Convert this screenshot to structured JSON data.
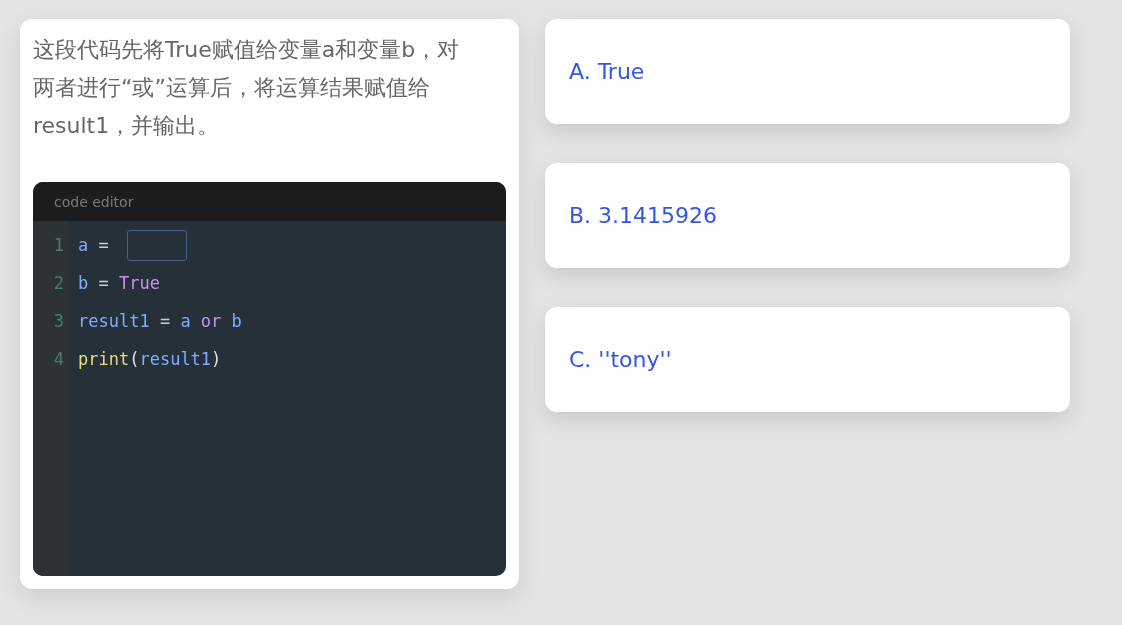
{
  "question": {
    "text": "这段代码先将True赋值给变量a和变量b，对两者进行“或”运算后，将运算结果赋值给result1，并输出。"
  },
  "code_editor": {
    "title": "code editor",
    "lines": [
      {
        "number": "1",
        "tokens": [
          {
            "kind": "variable",
            "text": "a"
          },
          {
            "kind": "operator",
            "text": " = "
          },
          {
            "kind": "blank"
          }
        ]
      },
      {
        "number": "2",
        "tokens": [
          {
            "kind": "variable",
            "text": "b"
          },
          {
            "kind": "operator",
            "text": " = "
          },
          {
            "kind": "boolean",
            "text": "True"
          }
        ]
      },
      {
        "number": "3",
        "tokens": [
          {
            "kind": "variable",
            "text": "result1"
          },
          {
            "kind": "operator",
            "text": " = "
          },
          {
            "kind": "variable",
            "text": "a"
          },
          {
            "kind": "keyword",
            "text": " or "
          },
          {
            "kind": "variable",
            "text": "b"
          }
        ]
      },
      {
        "number": "4",
        "tokens": [
          {
            "kind": "function",
            "text": "print"
          },
          {
            "kind": "punctuation",
            "text": "("
          },
          {
            "kind": "variable",
            "text": "result1"
          },
          {
            "kind": "punctuation",
            "text": ")"
          }
        ]
      }
    ]
  },
  "options": [
    {
      "label": "A. True",
      "selected": false
    },
    {
      "label": "B. 3.1415926",
      "selected": false
    },
    {
      "label": "C. ''tony''",
      "selected": false
    }
  ]
}
